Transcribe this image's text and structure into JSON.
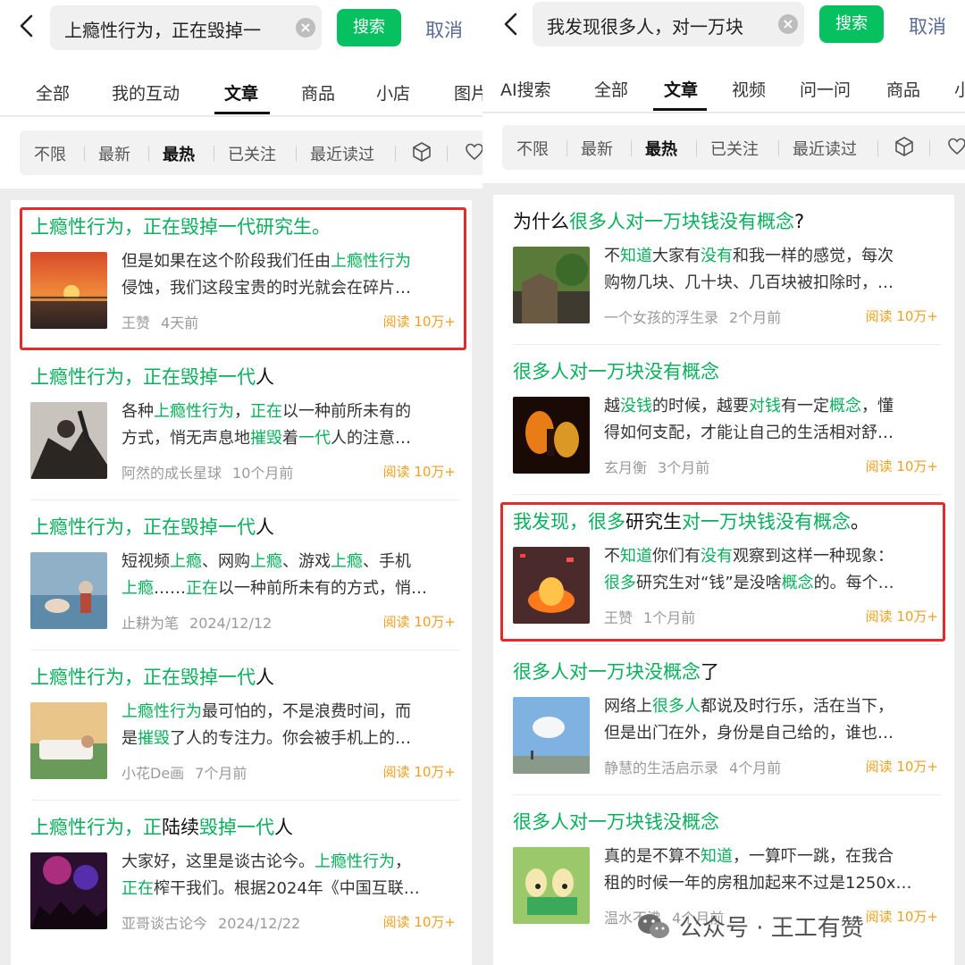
{
  "left": {
    "search": {
      "query": "上瘾性行为，正在毁掉一",
      "button": "搜索",
      "cancel": "取消"
    },
    "tabs": [
      "全部",
      "我的互动",
      "文章",
      "商品",
      "小店",
      "图片"
    ],
    "active_tab": "文章",
    "filters": [
      "不限",
      "最新",
      "最热",
      "已关注",
      "最近读过"
    ],
    "active_filter": "最热",
    "results": [
      {
        "title": [
          [
            "上瘾性行为，正在毁掉一代研究生。",
            "g"
          ]
        ],
        "snippet1": [
          [
            "但是如果在这个阶段我们任由",
            ""
          ],
          [
            "上瘾性行为",
            "g"
          ]
        ],
        "snippet2": [
          [
            "侵蚀，我们这段宝贵的时光就会在碎片…",
            ""
          ]
        ],
        "author": "王赞",
        "time": "4天前",
        "reads": "阅读 10万+"
      },
      {
        "title": [
          [
            "上瘾性行为，正在毁掉一代",
            "g"
          ],
          [
            "人",
            "b"
          ]
        ],
        "snippet1": [
          [
            "各种",
            ""
          ],
          [
            "上瘾性行为",
            "g"
          ],
          [
            "，",
            ""
          ],
          [
            "正在",
            "g"
          ],
          [
            "以一种前所未有的",
            ""
          ]
        ],
        "snippet2": [
          [
            "方式，悄无声息地",
            ""
          ],
          [
            "摧毁",
            "g"
          ],
          [
            "着",
            ""
          ],
          [
            "一代",
            "g"
          ],
          [
            "人的注意…",
            ""
          ]
        ],
        "author": "阿然的成长星球",
        "time": "10个月前",
        "reads": "阅读 10万+"
      },
      {
        "title": [
          [
            "上瘾性行为，正在毁掉一代",
            "g"
          ],
          [
            "人",
            "b"
          ]
        ],
        "snippet1": [
          [
            "短视频",
            ""
          ],
          [
            "上瘾",
            "g"
          ],
          [
            "、网购",
            ""
          ],
          [
            "上瘾",
            "g"
          ],
          [
            "、游戏",
            ""
          ],
          [
            "上瘾",
            "g"
          ],
          [
            "、手机",
            ""
          ]
        ],
        "snippet2": [
          [
            "上瘾",
            "g"
          ],
          [
            "……",
            ""
          ],
          [
            "正在",
            "g"
          ],
          [
            "以一种前所未有的方式，悄…",
            ""
          ]
        ],
        "author": "止耕为笔",
        "time": "2024/12/12",
        "reads": "阅读 10万+"
      },
      {
        "title": [
          [
            "上瘾性行为，正在毁掉一代",
            "g"
          ],
          [
            "人",
            "b"
          ]
        ],
        "snippet1": [
          [
            "上瘾性行为",
            "g"
          ],
          [
            "最可怕的，不是浪费时间，而",
            ""
          ]
        ],
        "snippet2": [
          [
            "是",
            ""
          ],
          [
            "摧毁",
            "g"
          ],
          [
            "了人的专注力。你会被手机上的…",
            ""
          ]
        ],
        "author": "小花De画",
        "time": "7个月前",
        "reads": "阅读 10万+"
      },
      {
        "title": [
          [
            "上瘾性行为，正",
            "g"
          ],
          [
            "陆续",
            "b"
          ],
          [
            "毁掉一代",
            "g"
          ],
          [
            "人",
            "b"
          ]
        ],
        "snippet1": [
          [
            "大家好，这里是谈古论今。",
            ""
          ],
          [
            "上瘾性行为",
            "g"
          ],
          [
            "，",
            ""
          ]
        ],
        "snippet2": [
          [
            "正在",
            "g"
          ],
          [
            "榨干我们。根据2024年《中国互联…",
            ""
          ]
        ],
        "author": "亚哥谈古论今",
        "time": "2024/12/22",
        "reads": "阅读 10万+"
      }
    ]
  },
  "right": {
    "search": {
      "query": "我发现很多人，对一万块",
      "button": "搜索",
      "cancel": "取消"
    },
    "tabs": [
      "AI搜索",
      "全部",
      "文章",
      "视频",
      "问一问",
      "商品",
      "小"
    ],
    "active_tab": "文章",
    "filters": [
      "不限",
      "最新",
      "最热",
      "已关注",
      "最近读过"
    ],
    "active_filter": "最热",
    "results": [
      {
        "title": [
          [
            "为什么",
            "b"
          ],
          [
            "很多人对一万块钱没有概念",
            "g"
          ],
          [
            "?",
            "b"
          ]
        ],
        "snippet1": [
          [
            "不",
            ""
          ],
          [
            "知道",
            "g"
          ],
          [
            "大家有",
            ""
          ],
          [
            "没有",
            "g"
          ],
          [
            "和我一样的感觉，每次",
            ""
          ]
        ],
        "snippet2": [
          [
            "购物几块、几十块、几百块被扣除时，…",
            ""
          ]
        ],
        "author": "一个女孩的浮生录",
        "time": "2个月前",
        "reads": "阅读 10万+"
      },
      {
        "title": [
          [
            "很多人对一万块没有概念",
            "g"
          ]
        ],
        "snippet1": [
          [
            "越",
            ""
          ],
          [
            "没钱",
            "g"
          ],
          [
            "的时候，越要",
            ""
          ],
          [
            "对钱",
            "g"
          ],
          [
            "有一定",
            ""
          ],
          [
            "概念",
            "g"
          ],
          [
            "，懂",
            ""
          ]
        ],
        "snippet2": [
          [
            "得如何支配，才能让自己的生活相对舒…",
            ""
          ]
        ],
        "author": "玄月衡",
        "time": "3个月前",
        "reads": "阅读 10万+"
      },
      {
        "title": [
          [
            "我发现，很多",
            "g"
          ],
          [
            "研究生",
            "b"
          ],
          [
            "对一万块钱没有概念",
            "g"
          ],
          [
            "。",
            "b"
          ]
        ],
        "snippet1": [
          [
            "不",
            ""
          ],
          [
            "知道",
            "g"
          ],
          [
            "你们有",
            ""
          ],
          [
            "没有",
            "g"
          ],
          [
            "观察到这样一种现象：",
            ""
          ]
        ],
        "snippet2": [
          [
            "很多",
            "g"
          ],
          [
            "研究生对“钱”是没啥",
            ""
          ],
          [
            "概念",
            "g"
          ],
          [
            "的。每个…",
            ""
          ]
        ],
        "author": "王赞",
        "time": "1个月前",
        "reads": "阅读 10万+"
      },
      {
        "title": [
          [
            "很多人对一万块没概念",
            "g"
          ],
          [
            "了",
            "b"
          ]
        ],
        "snippet1": [
          [
            "网络上",
            ""
          ],
          [
            "很多人",
            "g"
          ],
          [
            "都说及时行乐，活在当下，",
            ""
          ]
        ],
        "snippet2": [
          [
            "但是出门在外，身份是自己给的，谁也…",
            ""
          ]
        ],
        "author": "静慧的生活启示录",
        "time": "4个月前",
        "reads": "阅读 10万+"
      },
      {
        "title": [
          [
            "很多人对一万块钱没概念",
            "g"
          ]
        ],
        "snippet1": [
          [
            "真的是不算不",
            ""
          ],
          [
            "知道",
            "g"
          ],
          [
            "，一算吓一跳，在我合",
            ""
          ]
        ],
        "snippet2": [
          [
            "租的时候一年的房租加起来不过是1250x…",
            ""
          ]
        ],
        "author": "温水不沸",
        "time": "4个月前",
        "reads": "阅读 10万+"
      }
    ]
  },
  "watermark": "公众号 · 王工有赞"
}
